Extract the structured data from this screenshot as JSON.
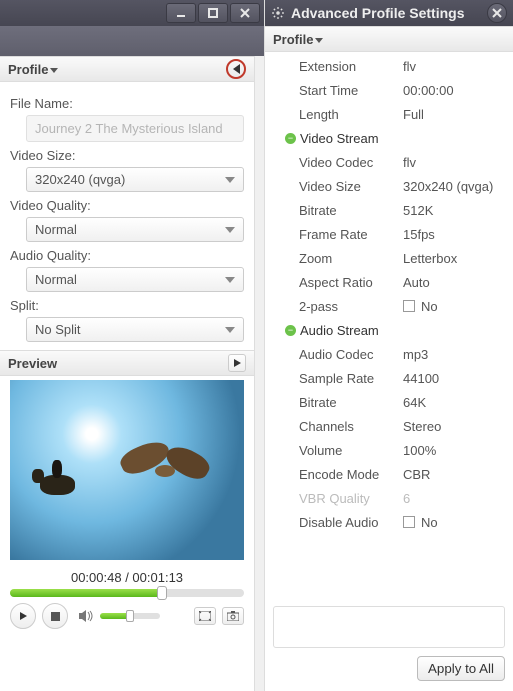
{
  "leftPanel": {
    "profileHeader": "Profile",
    "fileName": {
      "label": "File Name:",
      "value": "Journey 2 The Mysterious Island"
    },
    "videoSize": {
      "label": "Video Size:",
      "value": "320x240 (qvga)"
    },
    "videoQuality": {
      "label": "Video Quality:",
      "value": "Normal"
    },
    "audioQuality": {
      "label": "Audio Quality:",
      "value": "Normal"
    },
    "split": {
      "label": "Split:",
      "value": "No Split"
    },
    "previewHeader": "Preview",
    "time": {
      "current": "00:00:48",
      "sep": " / ",
      "total": "00:01:13"
    }
  },
  "rightPanel": {
    "title": "Advanced Profile Settings",
    "profileHeader": "Profile",
    "groups": {
      "general": [
        {
          "label": "Extension",
          "value": "flv"
        },
        {
          "label": "Start Time",
          "value": "00:00:00"
        },
        {
          "label": "Length",
          "value": "Full"
        }
      ],
      "videoStream": {
        "title": "Video Stream",
        "rows": [
          {
            "label": "Video Codec",
            "value": "flv"
          },
          {
            "label": "Video Size",
            "value": "320x240 (qvga)"
          },
          {
            "label": "Bitrate",
            "value": "512K"
          },
          {
            "label": "Frame Rate",
            "value": "15fps"
          },
          {
            "label": "Zoom",
            "value": "Letterbox"
          },
          {
            "label": "Aspect Ratio",
            "value": "Auto"
          },
          {
            "label": "2-pass",
            "value": "No",
            "checkbox": true
          }
        ]
      },
      "audioStream": {
        "title": "Audio Stream",
        "rows": [
          {
            "label": "Audio Codec",
            "value": "mp3"
          },
          {
            "label": "Sample Rate",
            "value": "44100"
          },
          {
            "label": "Bitrate",
            "value": "64K"
          },
          {
            "label": "Channels",
            "value": "Stereo"
          },
          {
            "label": "Volume",
            "value": "100%"
          },
          {
            "label": "Encode Mode",
            "value": "CBR"
          },
          {
            "label": "VBR Quality",
            "value": "6",
            "disabled": true
          },
          {
            "label": "Disable Audio",
            "value": "No",
            "checkbox": true
          }
        ]
      }
    },
    "applyButton": "Apply to All"
  }
}
